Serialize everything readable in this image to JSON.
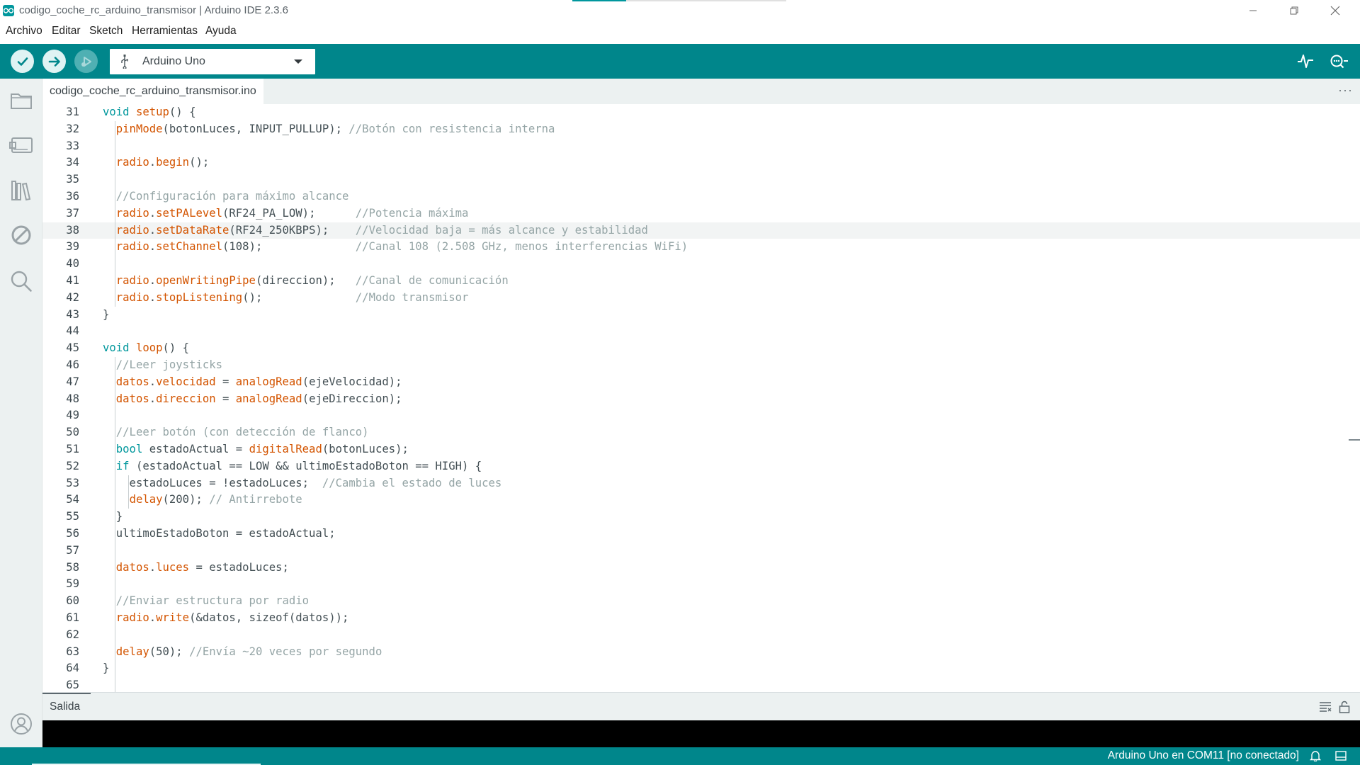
{
  "window": {
    "title": "codigo_coche_rc_arduino_transmisor | Arduino IDE 2.3.6",
    "title_progress": 0.25,
    "controls": [
      "minimize-icon",
      "restore-icon",
      "close-icon"
    ]
  },
  "menu": {
    "items": [
      "Archivo",
      "Editar",
      "Sketch",
      "Herramientas",
      "Ayuda"
    ]
  },
  "toolbar": {
    "verify_icon": "check-icon",
    "upload_icon": "arrow-right-icon",
    "debug_icon": "debug-icon",
    "board": "Arduino Uno",
    "board_icon": "usb-icon",
    "right_icons": [
      "serial-plotter-icon",
      "serial-monitor-icon"
    ]
  },
  "sidebar": {
    "icons": [
      "folder-icon",
      "board-manager-icon",
      "library-icon",
      "debug-disabled-icon",
      "search-icon",
      "account-icon"
    ]
  },
  "editor": {
    "tab_label": "codigo_coche_rc_arduino_transmisor.ino",
    "more_label": "···",
    "current_line": 38,
    "lines": [
      {
        "n": "31",
        "tokens": [
          {
            "t": "void",
            "c": "kw"
          },
          {
            "t": " "
          },
          {
            "t": "setup",
            "c": "fn"
          },
          {
            "t": "() {"
          }
        ]
      },
      {
        "n": "32",
        "tokens": [
          {
            "t": "  "
          },
          {
            "t": "pinMode",
            "c": "fn"
          },
          {
            "t": "(botonLuces, INPUT_PULLUP); "
          },
          {
            "t": "//Botón con resistencia interna",
            "c": "cm"
          }
        ]
      },
      {
        "n": "33",
        "tokens": []
      },
      {
        "n": "34",
        "tokens": [
          {
            "t": "  "
          },
          {
            "t": "radio",
            "c": "fn"
          },
          {
            "t": "."
          },
          {
            "t": "begin",
            "c": "fn"
          },
          {
            "t": "();"
          }
        ]
      },
      {
        "n": "35",
        "tokens": []
      },
      {
        "n": "36",
        "tokens": [
          {
            "t": "  "
          },
          {
            "t": "//Configuración para máximo alcance",
            "c": "cm"
          }
        ]
      },
      {
        "n": "37",
        "tokens": [
          {
            "t": "  "
          },
          {
            "t": "radio",
            "c": "fn"
          },
          {
            "t": "."
          },
          {
            "t": "setPALevel",
            "c": "fn"
          },
          {
            "t": "(RF24_PA_LOW);      "
          },
          {
            "t": "//Potencia máxima",
            "c": "cm"
          }
        ]
      },
      {
        "n": "38",
        "tokens": [
          {
            "t": "  "
          },
          {
            "t": "radio",
            "c": "fn"
          },
          {
            "t": "."
          },
          {
            "t": "setDataRate",
            "c": "fn"
          },
          {
            "t": "(RF24_250KBPS);    "
          },
          {
            "t": "//Velocidad baja = más alcance y estabilidad",
            "c": "cm"
          }
        ]
      },
      {
        "n": "39",
        "tokens": [
          {
            "t": "  "
          },
          {
            "t": "radio",
            "c": "fn"
          },
          {
            "t": "."
          },
          {
            "t": "setChannel",
            "c": "fn"
          },
          {
            "t": "(108);              "
          },
          {
            "t": "//Canal 108 (2.508 GHz, menos interferencias WiFi)",
            "c": "cm"
          }
        ]
      },
      {
        "n": "40",
        "tokens": []
      },
      {
        "n": "41",
        "tokens": [
          {
            "t": "  "
          },
          {
            "t": "radio",
            "c": "fn"
          },
          {
            "t": "."
          },
          {
            "t": "openWritingPipe",
            "c": "fn"
          },
          {
            "t": "(direccion);   "
          },
          {
            "t": "//Canal de comunicación",
            "c": "cm"
          }
        ]
      },
      {
        "n": "42",
        "tokens": [
          {
            "t": "  "
          },
          {
            "t": "radio",
            "c": "fn"
          },
          {
            "t": "."
          },
          {
            "t": "stopListening",
            "c": "fn"
          },
          {
            "t": "();              "
          },
          {
            "t": "//Modo transmisor",
            "c": "cm"
          }
        ]
      },
      {
        "n": "43",
        "tokens": [
          {
            "t": "}"
          }
        ]
      },
      {
        "n": "44",
        "tokens": []
      },
      {
        "n": "45",
        "tokens": [
          {
            "t": "void",
            "c": "kw"
          },
          {
            "t": " "
          },
          {
            "t": "loop",
            "c": "fn"
          },
          {
            "t": "() {"
          }
        ]
      },
      {
        "n": "46",
        "tokens": [
          {
            "t": "  "
          },
          {
            "t": "//Leer joysticks",
            "c": "cm"
          }
        ]
      },
      {
        "n": "47",
        "tokens": [
          {
            "t": "  "
          },
          {
            "t": "datos",
            "c": "fn"
          },
          {
            "t": "."
          },
          {
            "t": "velocidad",
            "c": "fn"
          },
          {
            "t": " = "
          },
          {
            "t": "analogRead",
            "c": "fn"
          },
          {
            "t": "(ejeVelocidad);"
          }
        ]
      },
      {
        "n": "48",
        "tokens": [
          {
            "t": "  "
          },
          {
            "t": "datos",
            "c": "fn"
          },
          {
            "t": "."
          },
          {
            "t": "direccion",
            "c": "fn"
          },
          {
            "t": " = "
          },
          {
            "t": "analogRead",
            "c": "fn"
          },
          {
            "t": "(ejeDireccion);"
          }
        ]
      },
      {
        "n": "49",
        "tokens": []
      },
      {
        "n": "50",
        "tokens": [
          {
            "t": "  "
          },
          {
            "t": "//Leer botón (con detección de flanco)",
            "c": "cm"
          }
        ]
      },
      {
        "n": "51",
        "tokens": [
          {
            "t": "  "
          },
          {
            "t": "bool",
            "c": "kw"
          },
          {
            "t": " estadoActual = "
          },
          {
            "t": "digitalRead",
            "c": "fn"
          },
          {
            "t": "(botonLuces);"
          }
        ]
      },
      {
        "n": "52",
        "tokens": [
          {
            "t": "  "
          },
          {
            "t": "if",
            "c": "kw"
          },
          {
            "t": " (estadoActual == LOW && ultimoEstadoBoton == HIGH) {"
          }
        ]
      },
      {
        "n": "53",
        "tokens": [
          {
            "t": "    estadoLuces = !estadoLuces;  "
          },
          {
            "t": "//Cambia el estado de luces",
            "c": "cm"
          }
        ]
      },
      {
        "n": "54",
        "tokens": [
          {
            "t": "    "
          },
          {
            "t": "delay",
            "c": "fn"
          },
          {
            "t": "(200); "
          },
          {
            "t": "// Antirrebote",
            "c": "cm"
          }
        ]
      },
      {
        "n": "55",
        "tokens": [
          {
            "t": "  }"
          }
        ]
      },
      {
        "n": "56",
        "tokens": [
          {
            "t": "  ultimoEstadoBoton = estadoActual;"
          }
        ]
      },
      {
        "n": "57",
        "tokens": []
      },
      {
        "n": "58",
        "tokens": [
          {
            "t": "  "
          },
          {
            "t": "datos",
            "c": "fn"
          },
          {
            "t": "."
          },
          {
            "t": "luces",
            "c": "fn"
          },
          {
            "t": " = estadoLuces;"
          }
        ]
      },
      {
        "n": "59",
        "tokens": []
      },
      {
        "n": "60",
        "tokens": [
          {
            "t": "  "
          },
          {
            "t": "//Enviar estructura por radio",
            "c": "cm"
          }
        ]
      },
      {
        "n": "61",
        "tokens": [
          {
            "t": "  "
          },
          {
            "t": "radio",
            "c": "fn"
          },
          {
            "t": "."
          },
          {
            "t": "write",
            "c": "fn"
          },
          {
            "t": "(&datos, sizeof(datos));"
          }
        ]
      },
      {
        "n": "62",
        "tokens": []
      },
      {
        "n": "63",
        "tokens": [
          {
            "t": "  "
          },
          {
            "t": "delay",
            "c": "fn"
          },
          {
            "t": "(50); "
          },
          {
            "t": "//Envía ~20 veces por segundo",
            "c": "cm"
          }
        ]
      },
      {
        "n": "64",
        "tokens": [
          {
            "t": "}"
          }
        ]
      },
      {
        "n": "65",
        "tokens": []
      }
    ]
  },
  "output": {
    "label": "Salida",
    "icons": [
      "clear-output-icon",
      "lock-icon"
    ]
  },
  "status": {
    "text": "Arduino Uno en COM11 [no conectado]",
    "icons": [
      "bell-icon",
      "panel-toggle-icon"
    ],
    "progress": 0.17
  },
  "colors": {
    "teal": "#00868b",
    "keyword": "#00979c",
    "function": "#d35400",
    "comment": "#95a5a6"
  }
}
